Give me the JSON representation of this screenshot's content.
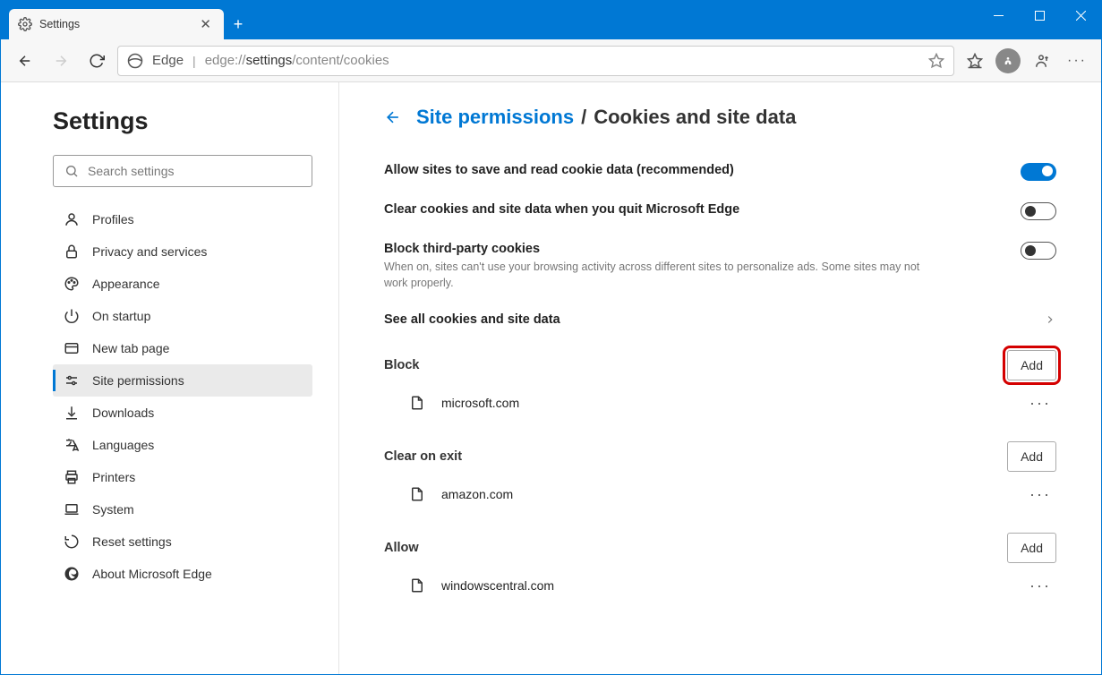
{
  "tab": {
    "title": "Settings"
  },
  "addressbar": {
    "label": "Edge",
    "url_prefix": "edge://",
    "url_mid": "settings",
    "url_rest": "/content/cookies"
  },
  "sidebar": {
    "title": "Settings",
    "search_placeholder": "Search settings",
    "items": [
      {
        "label": "Profiles"
      },
      {
        "label": "Privacy and services"
      },
      {
        "label": "Appearance"
      },
      {
        "label": "On startup"
      },
      {
        "label": "New tab page"
      },
      {
        "label": "Site permissions"
      },
      {
        "label": "Downloads"
      },
      {
        "label": "Languages"
      },
      {
        "label": "Printers"
      },
      {
        "label": "System"
      },
      {
        "label": "Reset settings"
      },
      {
        "label": "About Microsoft Edge"
      }
    ]
  },
  "breadcrumb": {
    "parent": "Site permissions",
    "sep": "/",
    "current": "Cookies and site data"
  },
  "settings": {
    "allow": {
      "label": "Allow sites to save and read cookie data (recommended)",
      "on": true
    },
    "clear": {
      "label": "Clear cookies and site data when you quit Microsoft Edge",
      "on": false
    },
    "block3": {
      "label": "Block third-party cookies",
      "desc": "When on, sites can't use your browsing activity across different sites to personalize ads. Some sites may not work properly.",
      "on": false
    },
    "seeall": {
      "label": "See all cookies and site data"
    }
  },
  "sections": {
    "block": {
      "label": "Block",
      "add": "Add",
      "sites": [
        "microsoft.com"
      ]
    },
    "clear_exit": {
      "label": "Clear on exit",
      "add": "Add",
      "sites": [
        "amazon.com"
      ]
    },
    "allow": {
      "label": "Allow",
      "add": "Add",
      "sites": [
        "windowscentral.com"
      ]
    }
  }
}
